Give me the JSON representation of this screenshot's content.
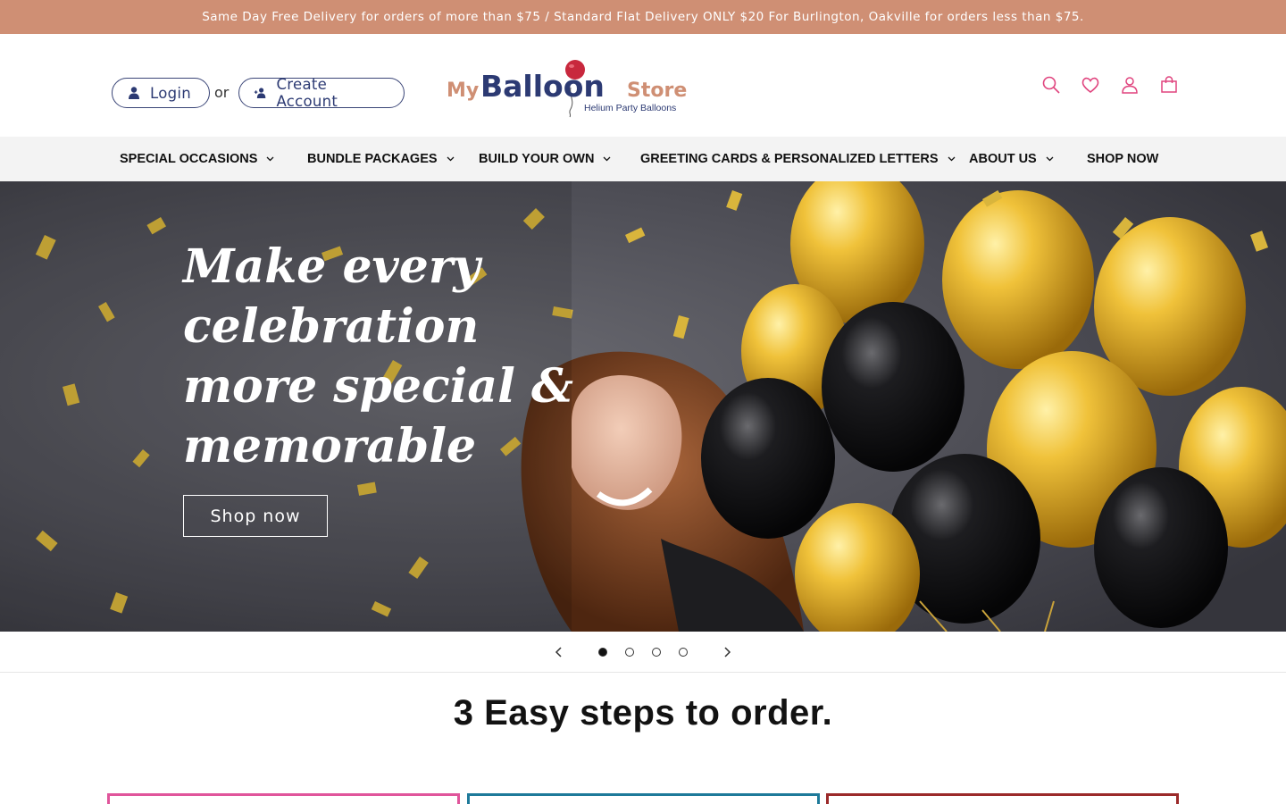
{
  "announcement": "Same Day Free Delivery for orders of more than $75 / Standard Flat Delivery ONLY $20 For Burlington, Oakville for orders less than $75.",
  "account": {
    "login_label": "Login",
    "or_label": "or",
    "create_label": "Create Account"
  },
  "logo": {
    "word_my": "My",
    "word_balloon": "Balloon",
    "word_store": "Store",
    "tagline": "Helium Party Balloons"
  },
  "header_icons": [
    "search-icon",
    "heart-icon",
    "account-icon",
    "cart-icon"
  ],
  "nav": {
    "items": [
      {
        "label": "SPECIAL OCCASIONS",
        "dropdown": true
      },
      {
        "label": "BUNDLE PACKAGES",
        "dropdown": true
      },
      {
        "label": "BUILD YOUR OWN",
        "dropdown": true
      },
      {
        "label": "GREETING CARDS & PERSONALIZED LETTERS",
        "dropdown": true
      },
      {
        "label": "ABOUT US",
        "dropdown": true
      },
      {
        "label": "SHOP NOW",
        "dropdown": false
      }
    ]
  },
  "hero": {
    "title": "Make every celebration more special & memorable",
    "button_label": "Shop now"
  },
  "slider": {
    "slide_count": 4,
    "active_slide": 1
  },
  "steps": {
    "title": "3 Easy steps to order."
  },
  "colors": {
    "announcement_bg": "#cf8f74",
    "brand_navy": "#2c3a73",
    "brand_pink": "#e0447e",
    "step_card_1": "#e0559b",
    "step_card_2": "#1e7a9a",
    "step_card_3": "#9b2a2a"
  }
}
